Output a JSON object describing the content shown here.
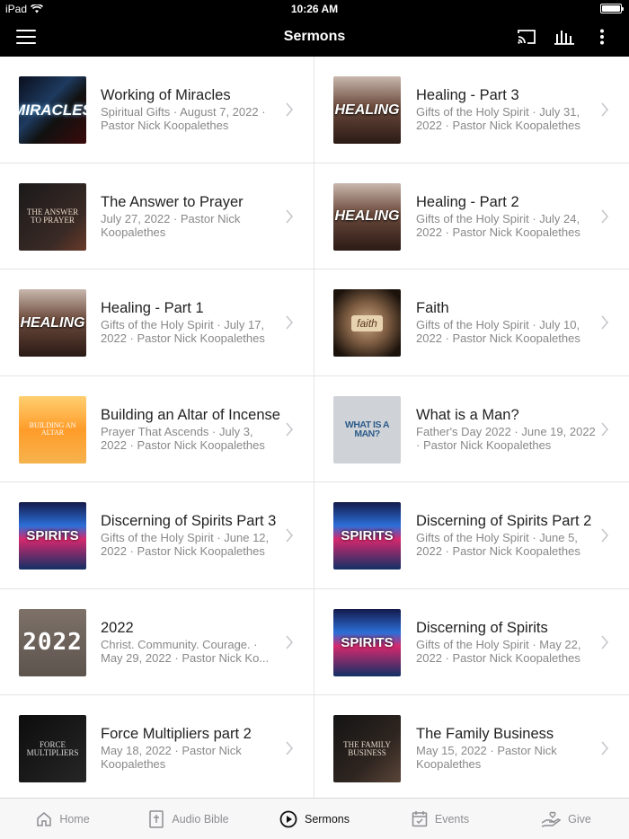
{
  "status": {
    "device": "iPad",
    "time": "10:26 AM"
  },
  "nav": {
    "title": "Sermons"
  },
  "sermons": [
    {
      "title": "Working of Miracles",
      "subtitle": "Spiritual Gifts · August 7, 2022 · Pastor Nick Koopalethes",
      "thumb": "MIRACLES",
      "thumb_style": "miracles"
    },
    {
      "title": "Healing - Part 3",
      "subtitle": "Gifts of the Holy Spirit · July 31, 2022 · Pastor Nick Koopalethes",
      "thumb": "HEALING",
      "thumb_style": "healing"
    },
    {
      "title": "The Answer to Prayer",
      "subtitle": "July 27, 2022 · Pastor Nick Koopalethes",
      "thumb": "THE ANSWER TO PRAYER",
      "thumb_style": "answer"
    },
    {
      "title": "Healing - Part 2",
      "subtitle": "Gifts of the Holy Spirit · July 24, 2022 · Pastor Nick Koopalethes",
      "thumb": "HEALING",
      "thumb_style": "healing"
    },
    {
      "title": "Healing - Part 1",
      "subtitle": "Gifts of the Holy Spirit · July 17, 2022 · Pastor Nick Koopalethes",
      "thumb": "HEALING",
      "thumb_style": "healing"
    },
    {
      "title": "Faith",
      "subtitle": "Gifts of the Holy Spirit · July 10, 2022 · Pastor Nick Koopalethes",
      "thumb": "faith",
      "thumb_style": "faith"
    },
    {
      "title": "Building an Altar of Incense",
      "subtitle": "Prayer That Ascends · July 3, 2022 · Pastor Nick Koopalethes",
      "thumb": "BUILDING AN ALTAR",
      "thumb_style": "altar"
    },
    {
      "title": "What is a Man?",
      "subtitle": "Father's Day 2022 · June 19, 2022 · Pastor Nick Koopalethes",
      "thumb": "WHAT IS A MAN?",
      "thumb_style": "man"
    },
    {
      "title": "Discerning of Spirits Part 3",
      "subtitle": "Gifts of the Holy Spirit · June 12, 2022 · Pastor Nick Koopalethes",
      "thumb": "SPIRITS",
      "thumb_style": "spirits"
    },
    {
      "title": "Discerning of Spirits Part 2",
      "subtitle": "Gifts of the Holy Spirit · June 5, 2022 · Pastor Nick Koopalethes",
      "thumb": "SPIRITS",
      "thumb_style": "spirits"
    },
    {
      "title": "2022",
      "subtitle": "Christ. Community. Courage. · May 29, 2022 · Pastor Nick Ko...",
      "thumb": "2022",
      "thumb_style": "year"
    },
    {
      "title": "Discerning of Spirits",
      "subtitle": "Gifts of the Holy Spirit · May 22, 2022 · Pastor Nick Koopalethes",
      "thumb": "SPIRITS",
      "thumb_style": "spirits"
    },
    {
      "title": "Force Multipliers part 2",
      "subtitle": "May 18, 2022 · Pastor Nick Koopalethes",
      "thumb": "FORCE MULTIPLIERS",
      "thumb_style": "force"
    },
    {
      "title": "The Family Business",
      "subtitle": "May 15, 2022 · Pastor Nick Koopalethes",
      "thumb": "THE FAMILY BUSINESS",
      "thumb_style": "family"
    }
  ],
  "tabs": [
    {
      "label": "Home",
      "icon": "home-icon",
      "active": false
    },
    {
      "label": "Audio Bible",
      "icon": "bible-icon",
      "active": false
    },
    {
      "label": "Sermons",
      "icon": "play-circle-icon",
      "active": true
    },
    {
      "label": "Events",
      "icon": "calendar-icon",
      "active": false
    },
    {
      "label": "Give",
      "icon": "give-hand-icon",
      "active": false
    }
  ]
}
